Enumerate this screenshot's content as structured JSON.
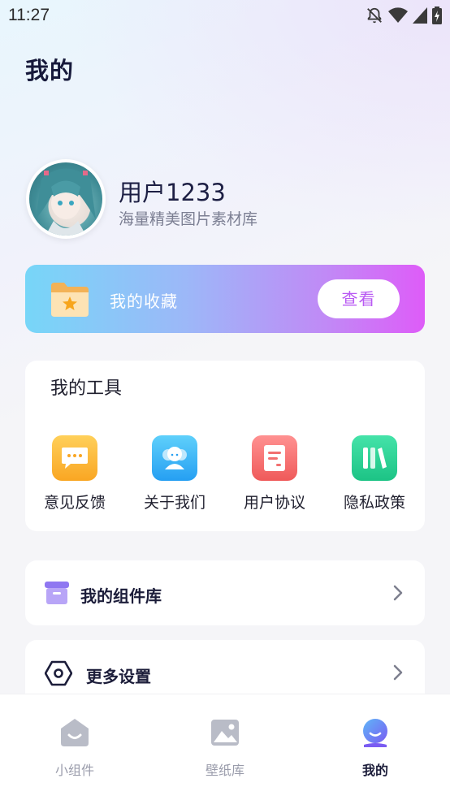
{
  "status_bar": {
    "time": "11:27",
    "icons": [
      "notifications-off-icon",
      "wifi-icon",
      "signal-icon",
      "battery-charging-icon"
    ]
  },
  "page": {
    "title": "我的"
  },
  "profile": {
    "avatar": "anime-avatar",
    "username": "用户1233",
    "subtitle": "海量精美图片素材库"
  },
  "favorites": {
    "label": "我的收藏",
    "button_label": "查看",
    "icon": "folder-star-icon",
    "gradient": [
      "#77d6f8",
      "#de5cf8"
    ]
  },
  "tools": {
    "title": "我的工具",
    "items": [
      {
        "label": "意见反馈",
        "icon": "feedback-chat-icon",
        "color": "#fbb040"
      },
      {
        "label": "关于我们",
        "icon": "about-people-icon",
        "color": "#38b6f5"
      },
      {
        "label": "用户协议",
        "icon": "agreement-document-icon",
        "color": "#f56f6f"
      },
      {
        "label": "隐私政策",
        "icon": "privacy-books-icon",
        "color": "#28d08f"
      }
    ]
  },
  "menu": {
    "items": [
      {
        "label": "我的组件库",
        "icon": "widget-box-icon"
      },
      {
        "label": "更多设置",
        "icon": "settings-hexagon-icon"
      }
    ]
  },
  "bottom_nav": {
    "items": [
      {
        "label": "小组件",
        "icon": "home-widget-icon",
        "active": false
      },
      {
        "label": "壁纸库",
        "icon": "wallpaper-image-icon",
        "active": false
      },
      {
        "label": "我的",
        "icon": "profile-face-icon",
        "active": true
      }
    ]
  },
  "colors": {
    "accent": "#b95af3",
    "title": "#171a3b",
    "nav_active_icon": "#5b7cf6"
  }
}
